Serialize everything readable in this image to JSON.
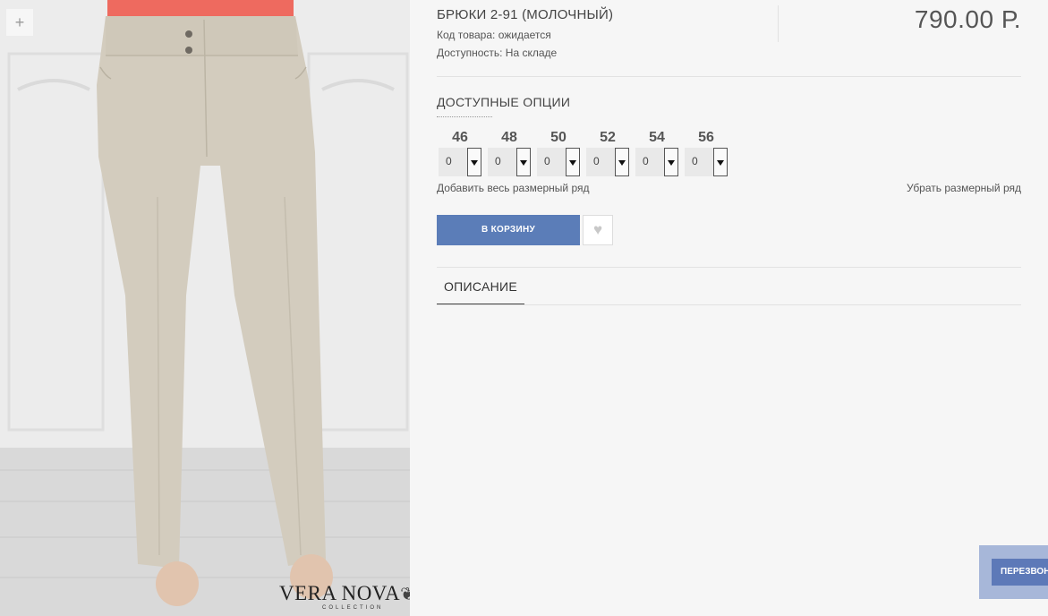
{
  "product": {
    "title": "БРЮКИ 2-91 (МОЛОЧНЫЙ)",
    "sku_line": "Код товара: ожидается",
    "availability_line": "Доступность: На складе",
    "price": "790.00 Р."
  },
  "gallery": {
    "zoom_label": "+",
    "brand_logo": "VERA NOVA",
    "brand_sub": "COLLECTION"
  },
  "options": {
    "heading": "ДОСТУПНЫЕ ОПЦИИ",
    "sizes": [
      {
        "size": "46",
        "qty": "0"
      },
      {
        "size": "48",
        "qty": "0"
      },
      {
        "size": "50",
        "qty": "0"
      },
      {
        "size": "52",
        "qty": "0"
      },
      {
        "size": "54",
        "qty": "0"
      },
      {
        "size": "56",
        "qty": "0"
      }
    ],
    "add_row_label": "Добавить весь размерный ряд",
    "remove_row_label": "Убрать размерный ряд"
  },
  "actions": {
    "cart_label": "В КОРЗИНУ",
    "wishlist_icon": "heart-icon",
    "wishlist_glyph": "♥"
  },
  "tabs": [
    {
      "label": "ОПИСАНИЕ"
    }
  ],
  "callback": {
    "label": "ПЕРЕЗВОНИТЕ"
  },
  "colors": {
    "accent": "#5b7db8",
    "callback_bg": "#a7b7d9",
    "trousers": "#d2cbbd",
    "top": "#ee6a5f"
  }
}
